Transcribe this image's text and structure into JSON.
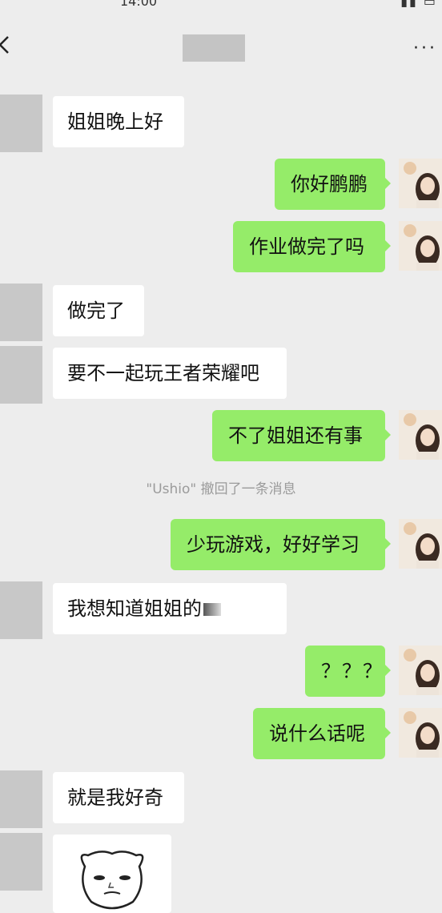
{
  "status": {
    "time": "14:00",
    "icons": ""
  },
  "header": {
    "title": ""
  },
  "messages": [
    {
      "side": "in",
      "text": "姐姐晚上好"
    },
    {
      "side": "out",
      "text": "你好鹏鹏"
    },
    {
      "side": "out",
      "text": "作业做完了吗"
    },
    {
      "side": "in",
      "text": "做完了"
    },
    {
      "side": "in",
      "text": "要不一起玩王者荣耀吧"
    },
    {
      "side": "out",
      "text": "不了姐姐还有事"
    },
    {
      "side": "out",
      "text": "少玩游戏，好好学习"
    },
    {
      "side": "in",
      "text": "我想知道姐姐的"
    },
    {
      "side": "out",
      "text": "？？？"
    },
    {
      "side": "out",
      "text": "说什么话呢"
    },
    {
      "side": "in",
      "text": "就是我好奇"
    }
  ],
  "system": {
    "recall_notice": "\"Ushio\" 撤回了一条消息"
  },
  "colors": {
    "background": "#ededed",
    "outgoing_bubble": "#95ec69",
    "incoming_bubble": "#ffffff"
  },
  "icons": [
    "back-arrow-icon",
    "more-dots-icon"
  ]
}
